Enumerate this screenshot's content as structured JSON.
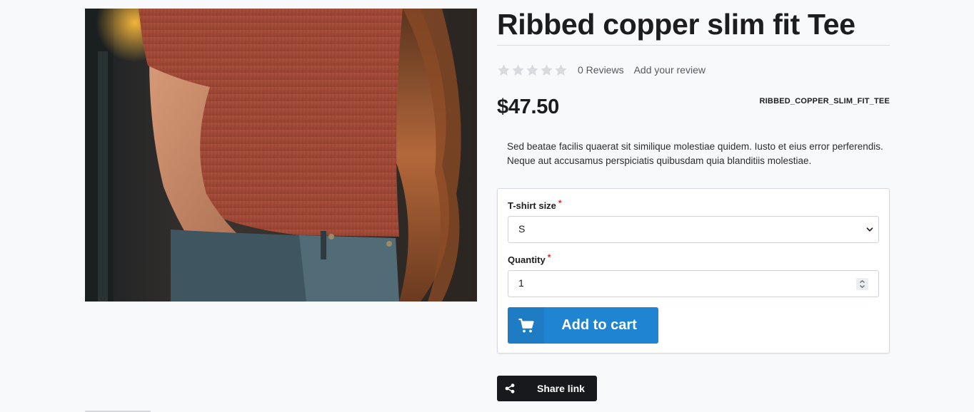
{
  "product": {
    "title": "Ribbed copper slim fit Tee",
    "reviews_label": "0 Reviews",
    "add_review_label": "Add your review",
    "rating": 0,
    "rating_max": 5,
    "price": "$47.50",
    "sku": "RIBBED_COPPER_SLIM_FIT_TEE",
    "description": "Sed beatae facilis quaerat sit similique molestiae quidem. Iusto et eius error perferendis. Neque aut accusamus perspiciatis quibusdam quia blanditiis molestiae.",
    "image_icon": "product-photo"
  },
  "options": {
    "size_label": "T-shirt size",
    "size_required": "*",
    "size_value": "S",
    "quantity_label": "Quantity",
    "quantity_required": "*",
    "quantity_value": "1",
    "add_to_cart_label": "Add to cart",
    "cart_icon": "cart-icon"
  },
  "share": {
    "label": "Share link",
    "icon": "share-icon"
  },
  "colors": {
    "primary": "#1f85d2",
    "dark_button": "#17191c",
    "required": "#d8262f",
    "star_empty": "#d9dadd"
  }
}
